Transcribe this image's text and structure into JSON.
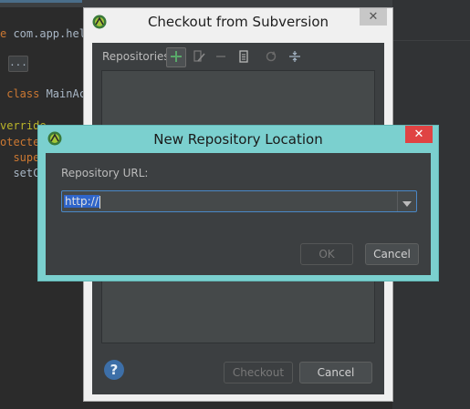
{
  "editor": {
    "code_lines": [
      {
        "kw": "e",
        "rest": " com.app.hel"
      },
      {
        "kw": "",
        "rest": ""
      },
      {
        "kw": "",
        "rest": ""
      },
      {
        "kw": "",
        "rest": ""
      },
      {
        "kw": " class",
        "rest": " MainAc"
      },
      {
        "kw": "",
        "rest": ""
      },
      {
        "kw": "verride",
        "rest": ""
      },
      {
        "kw": "otecte",
        "rest": ""
      },
      {
        "kw": "  supe",
        "rest": ""
      },
      {
        "kw": "",
        "rest": "  setC"
      }
    ],
    "fold_text": "..."
  },
  "checkout_dialog": {
    "title": "Checkout from Subversion",
    "close_glyph": "✕",
    "repositories_label": "Repositories:",
    "help_glyph": "?",
    "checkout_button": "Checkout",
    "cancel_button": "Cancel"
  },
  "new_repo_dialog": {
    "title": "New Repository Location",
    "close_glyph": "✕",
    "url_label": "Repository URL:",
    "url_value": "http://",
    "ok_button": "OK",
    "cancel_button": "Cancel"
  },
  "colors": {
    "dialog_frame_active": "#7bd0cf",
    "close_active": "#e04343",
    "dark_content": "#3c3f41",
    "selection": "#2f65ca"
  }
}
